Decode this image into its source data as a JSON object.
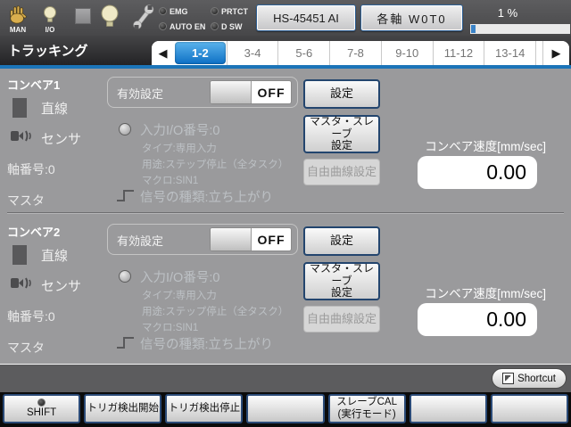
{
  "top_bar": {
    "mode_label": "MAN",
    "io_label": "I/O",
    "indicators": [
      {
        "label": "EMG"
      },
      {
        "label": "PRTCT"
      },
      {
        "label": "AUTO EN"
      },
      {
        "label": "D SW"
      }
    ],
    "robot_button": "HS-45451 AI",
    "axis_mode_button": "各軸 W0T0",
    "speed_percent": "1 %"
  },
  "title_bar": {
    "title": "トラッキング",
    "active_tab": "1-2",
    "tabs": [
      {
        "label": "1-2"
      },
      {
        "label": "3-4"
      },
      {
        "label": "5-6"
      },
      {
        "label": "7-8"
      },
      {
        "label": "9-10"
      },
      {
        "label": "11-12"
      },
      {
        "label": "13-14"
      }
    ]
  },
  "conveyors": [
    {
      "name": "コンベア1",
      "line_type_label": "直線",
      "sensor_label": "センサ",
      "axis_number_label": "軸番号:0",
      "master_label": "マスタ",
      "enable_setting_label": "有効設定",
      "enable_state": "OFF",
      "input_io_label": "入力I/O番号:0",
      "input_type": "タイプ:専用入力",
      "input_usage": "用途:ステップ停止（全タスク）",
      "input_macro": "マクロ:SIN1",
      "signal_type_label": "信号の種類:立ち上がり",
      "settings_button": "設定",
      "master_slave_line1": "マスタ・スレーブ",
      "master_slave_line2": "設定",
      "free_curve_button": "自由曲線設定",
      "speed_label": "コンベア速度[mm/sec]",
      "speed_value": "0.00"
    },
    {
      "name": "コンベア2",
      "line_type_label": "直線",
      "sensor_label": "センサ",
      "axis_number_label": "軸番号:0",
      "master_label": "マスタ",
      "enable_setting_label": "有効設定",
      "enable_state": "OFF",
      "input_io_label": "入力I/O番号:0",
      "input_type": "タイプ:専用入力",
      "input_usage": "用途:ステップ停止（全タスク）",
      "input_macro": "マクロ:SIN1",
      "signal_type_label": "信号の種類:立ち上がり",
      "settings_button": "設定",
      "master_slave_line1": "マスタ・スレーブ",
      "master_slave_line2": "設定",
      "free_curve_button": "自由曲線設定",
      "speed_label": "コンベア速度[mm/sec]",
      "speed_value": "0.00"
    }
  ],
  "shortcut": {
    "label": "Shortcut"
  },
  "function_keys": [
    {
      "label": "SHIFT"
    },
    {
      "label": "トリガ検出開始"
    },
    {
      "label": "トリガ検出停止"
    },
    {
      "label": ""
    },
    {
      "line1": "スレーブCAL",
      "line2": "(実行モード)"
    },
    {
      "label": ""
    },
    {
      "label": ""
    }
  ],
  "colors": {
    "accent_blue": "#1b74b8",
    "active_tab_blue": "#0d6fc4",
    "background_gray": "#9a9a9c"
  }
}
